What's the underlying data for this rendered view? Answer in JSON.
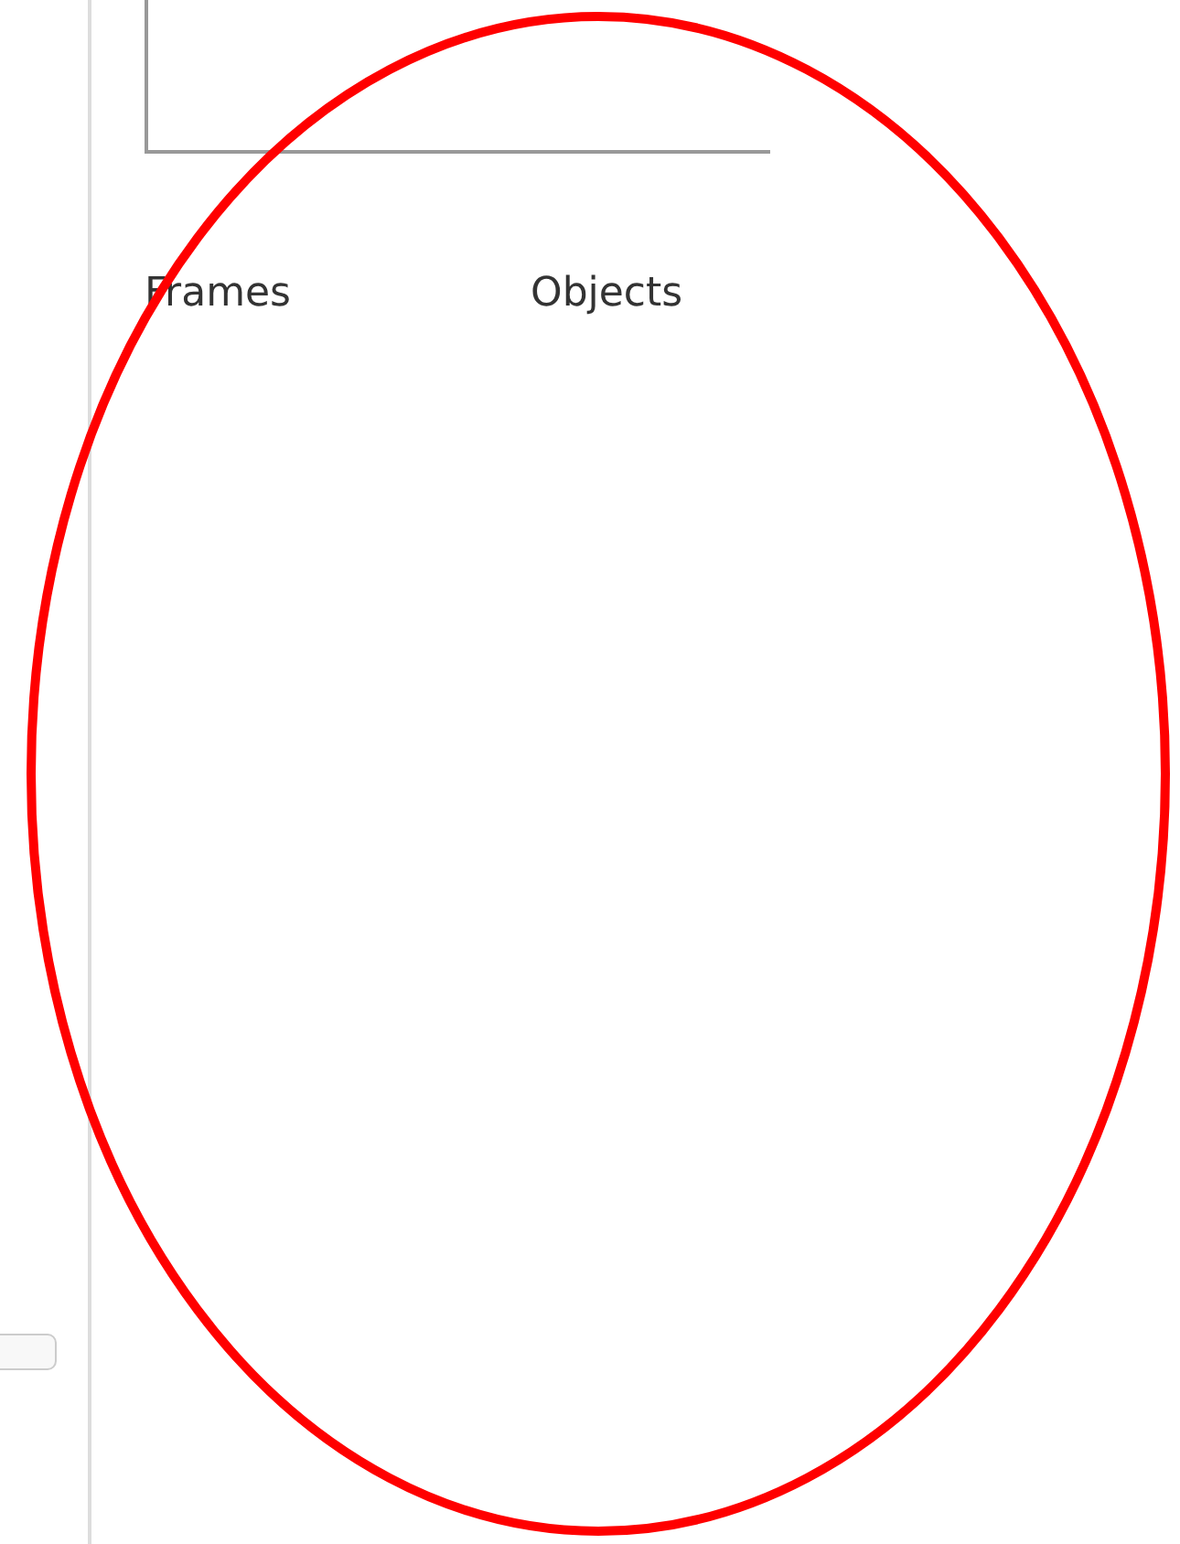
{
  "headings": [
    {
      "label": "Frames"
    },
    {
      "label": "Objects"
    }
  ]
}
